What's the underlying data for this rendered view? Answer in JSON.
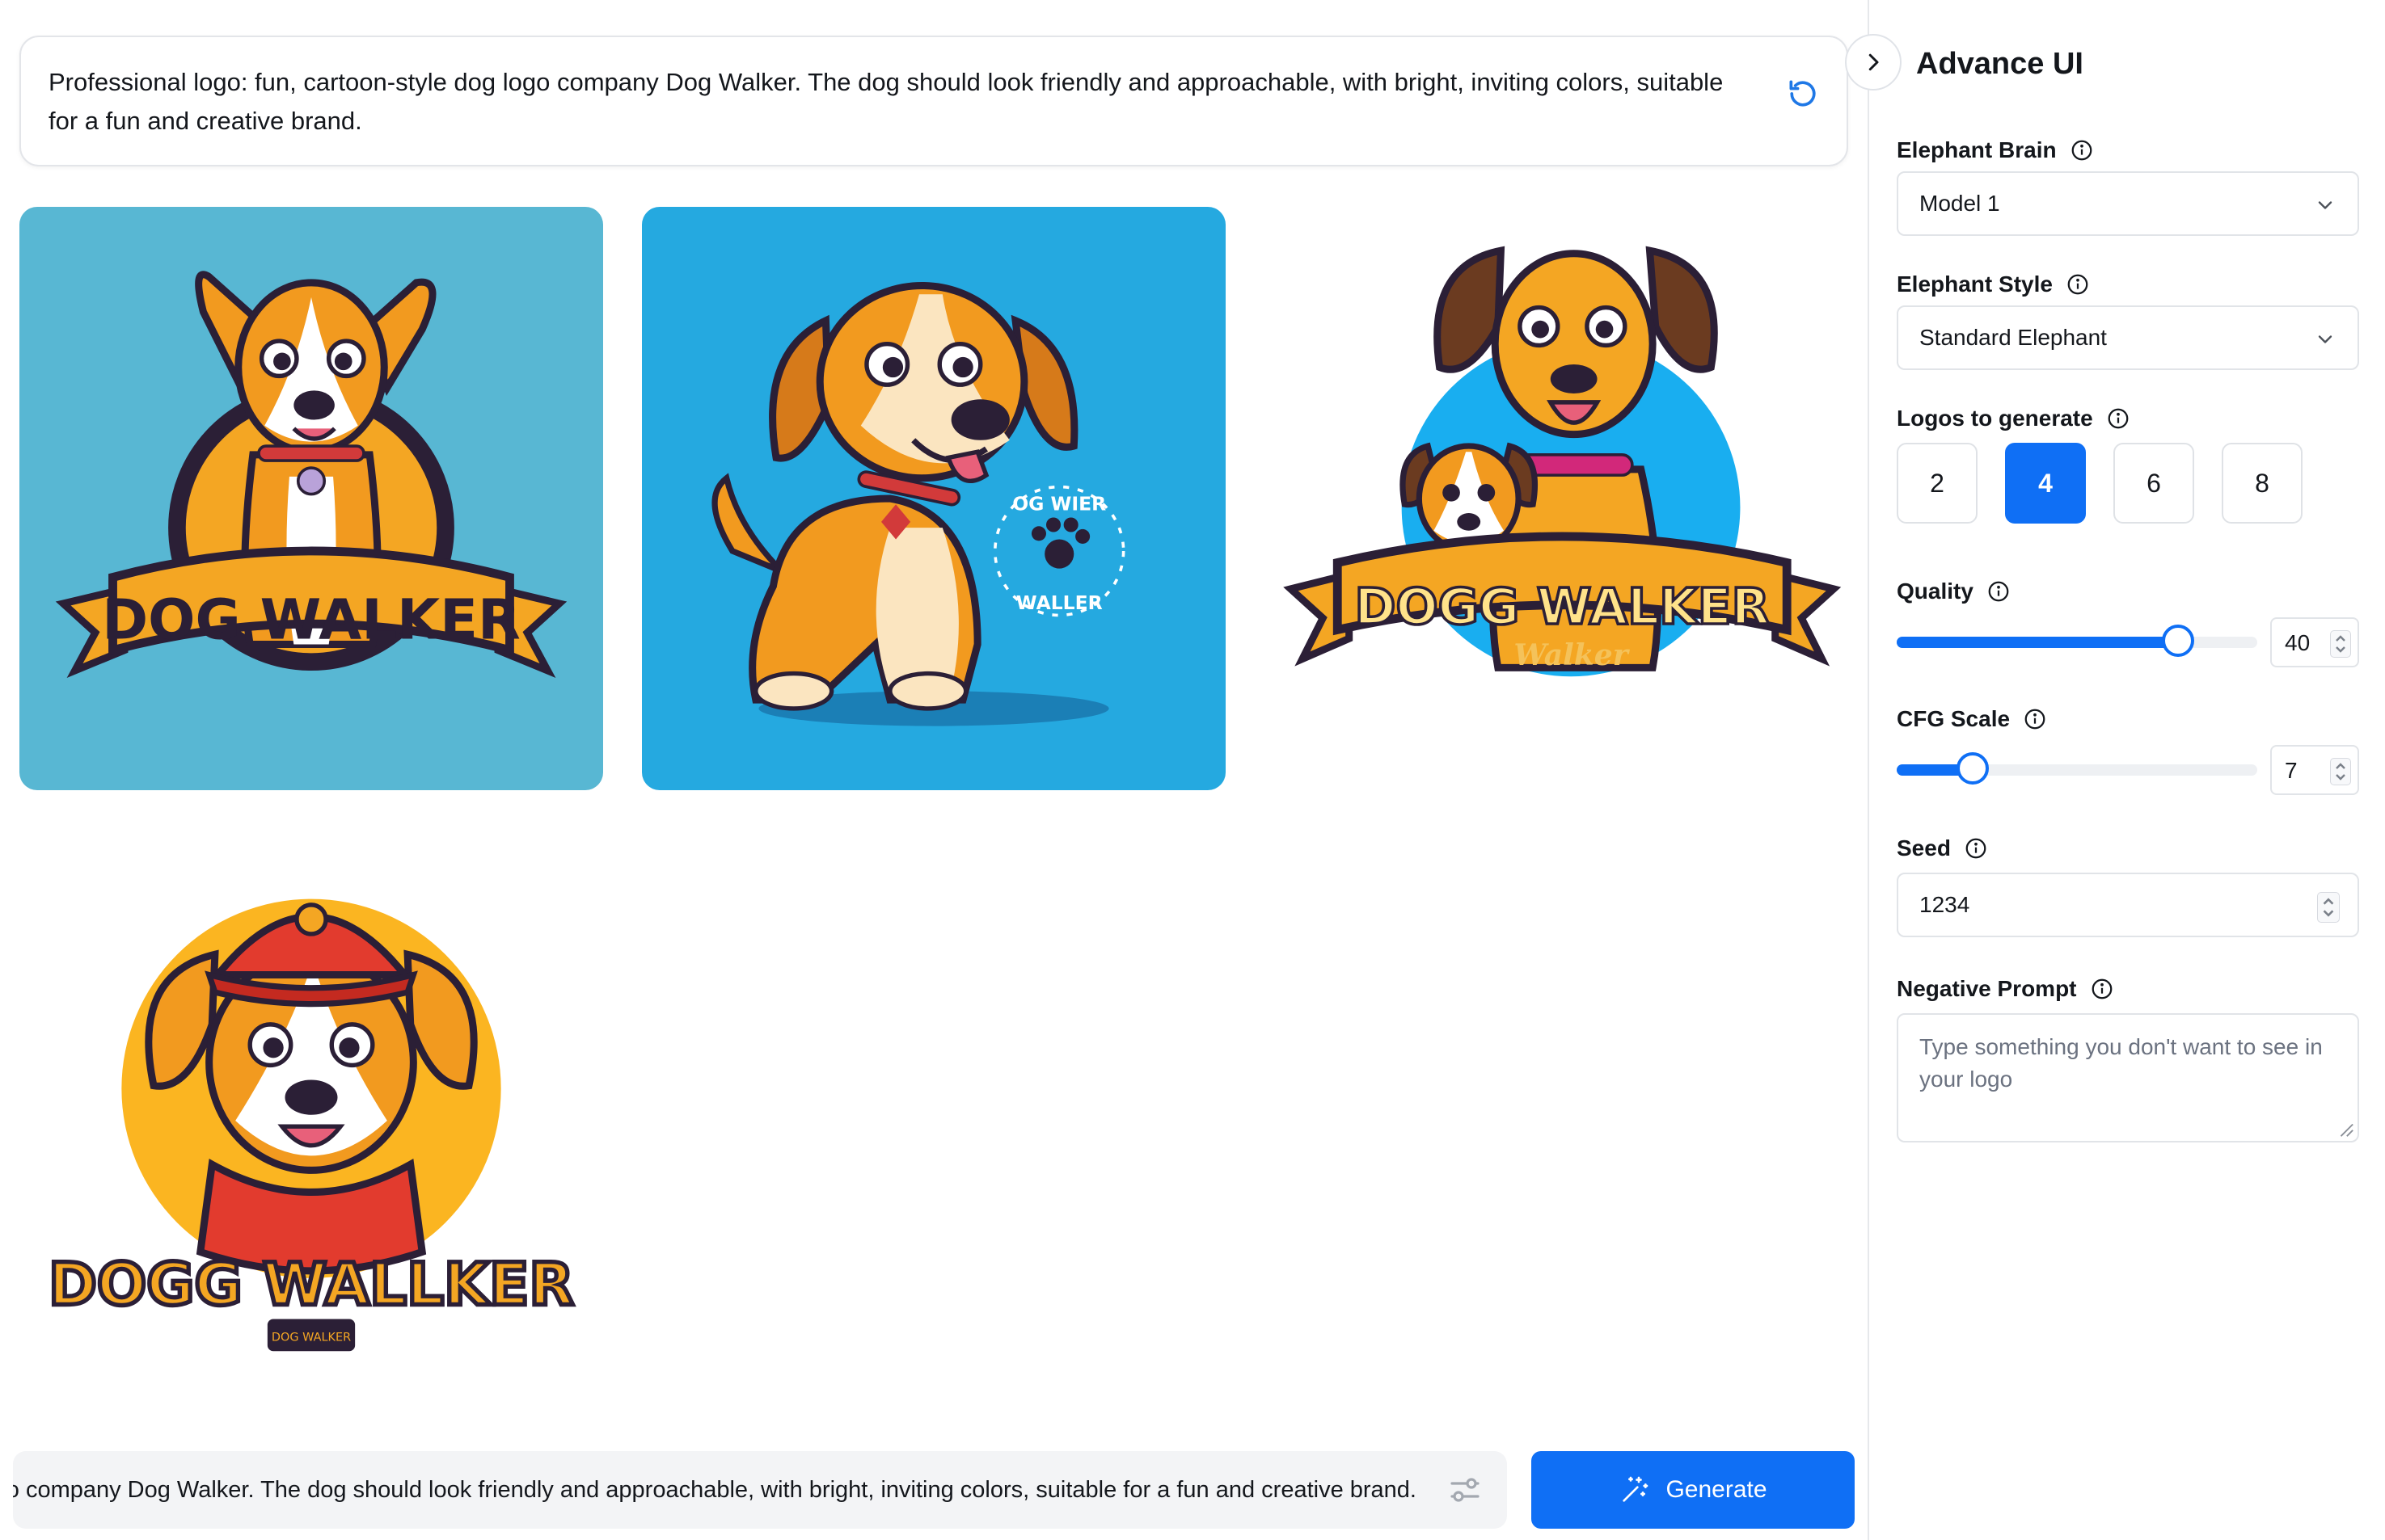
{
  "prompt": {
    "text": "Professional logo: fun, cartoon-style dog logo company Dog Walker. The dog should look friendly and approachable, with bright, inviting colors, suitable for a fun and creative brand.",
    "refresh_icon": "refresh-icon"
  },
  "gallery": {
    "logos": [
      {
        "banner": "DOG WALKER",
        "background": "#58b7d3"
      },
      {
        "badge_top": "OG WIER",
        "badge_bottom": "WALLER",
        "background": "#25a9e0"
      },
      {
        "banner": "DOGG WALKER",
        "sub": "Walker",
        "background": "#ffffff"
      },
      {
        "banner": "DOGG WALLKER",
        "sub": "DOG WALKER",
        "background": "#ffffff"
      }
    ]
  },
  "bottom_bar": {
    "prompt_text": "Professional logo: fun, cartoon-style dog logo company Dog Walker. The dog should look friendly and approachable, with bright, inviting colors, suitable for a fun and creative brand.",
    "generate_label": "Generate"
  },
  "panel": {
    "title": "Advance UI",
    "brain": {
      "label": "Elephant Brain",
      "value": "Model 1"
    },
    "style": {
      "label": "Elephant Style",
      "value": "Standard Elephant"
    },
    "logos_to_generate": {
      "label": "Logos to generate",
      "options": [
        "2",
        "4",
        "6",
        "8"
      ],
      "selected": "4"
    },
    "quality": {
      "label": "Quality",
      "value": "40",
      "fraction": 0.78
    },
    "cfg_scale": {
      "label": "CFG Scale",
      "value": "7",
      "fraction": 0.21
    },
    "seed": {
      "label": "Seed",
      "value": "1234"
    },
    "negative_prompt": {
      "label": "Negative Prompt",
      "placeholder": "Type something you don't want to see in your logo"
    }
  },
  "colors": {
    "accent": "#0f6ff5",
    "border": "#e1e4e8"
  }
}
